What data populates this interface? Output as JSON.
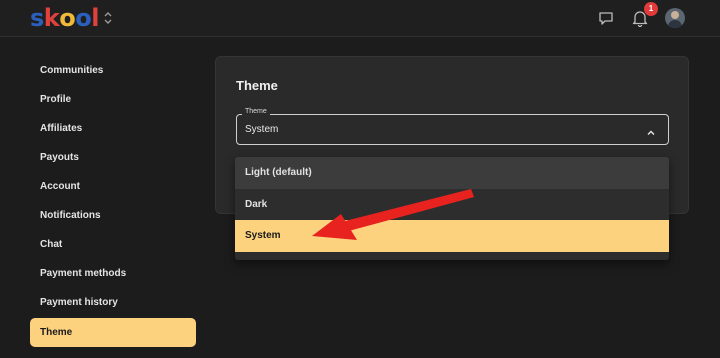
{
  "header": {
    "logo_letters": [
      "s",
      "k",
      "o",
      "o",
      "l"
    ],
    "logo_colors": [
      "#2b5fbd",
      "#e0413c",
      "#f0b93a",
      "#2b5fbd",
      "#e0413c"
    ],
    "notification_count": "1"
  },
  "sidebar": {
    "items": [
      {
        "label": "Communities"
      },
      {
        "label": "Profile"
      },
      {
        "label": "Affiliates"
      },
      {
        "label": "Payouts"
      },
      {
        "label": "Account"
      },
      {
        "label": "Notifications"
      },
      {
        "label": "Chat"
      },
      {
        "label": "Payment methods"
      },
      {
        "label": "Payment history"
      },
      {
        "label": "Theme"
      }
    ],
    "active": "Theme"
  },
  "panel": {
    "title": "Theme",
    "select_label": "Theme",
    "select_value": "System"
  },
  "dropdown": {
    "options": [
      {
        "label": "Light (default)"
      },
      {
        "label": "Dark"
      },
      {
        "label": "System"
      }
    ],
    "selected": "System"
  },
  "colors": {
    "accent": "#fcd27f",
    "annotation_arrow": "#e8231f",
    "badge": "#e03a3a"
  }
}
